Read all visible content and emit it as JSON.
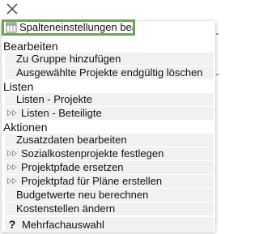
{
  "close_icon": "close-icon",
  "highlighted_item": {
    "label": "Spalteneinstellungen bearbeiten",
    "icon": "table-columns-icon",
    "highlight_color": "#6aa84f"
  },
  "sections": [
    {
      "title": "Bearbeiten",
      "items": [
        {
          "label": "Zu Gruppe hinzufügen",
          "icon": null
        },
        {
          "label": "Ausgewählte Projekte endgültig löschen",
          "icon": null
        }
      ]
    },
    {
      "title": "Listen",
      "items": [
        {
          "label": "Listen - Projekte",
          "icon": null
        },
        {
          "label": "Listen - Beteiligte",
          "icon": "submenu-arrow-icon"
        }
      ]
    },
    {
      "title": "Aktionen",
      "items": [
        {
          "label": "Zusatzdaten bearbeiten",
          "icon": null
        },
        {
          "label": "Sozialkostenprojekte festlegen",
          "icon": "submenu-arrow-icon"
        },
        {
          "label": "Projektpfade ersetzen",
          "icon": "submenu-arrow-icon"
        },
        {
          "label": "Projektpfad für Pläne erstellen",
          "icon": "submenu-arrow-icon"
        },
        {
          "label": "Budgetwerte neu berechnen",
          "icon": null
        },
        {
          "label": "Kostenstellen ändern",
          "icon": null
        }
      ]
    }
  ],
  "help_item": {
    "label": "Mehrfachauswahl",
    "glyph": "?"
  },
  "colors": {
    "item_background": "#f1f1f1",
    "text": "#111111",
    "arrow_icon": "#9a9a9a"
  }
}
